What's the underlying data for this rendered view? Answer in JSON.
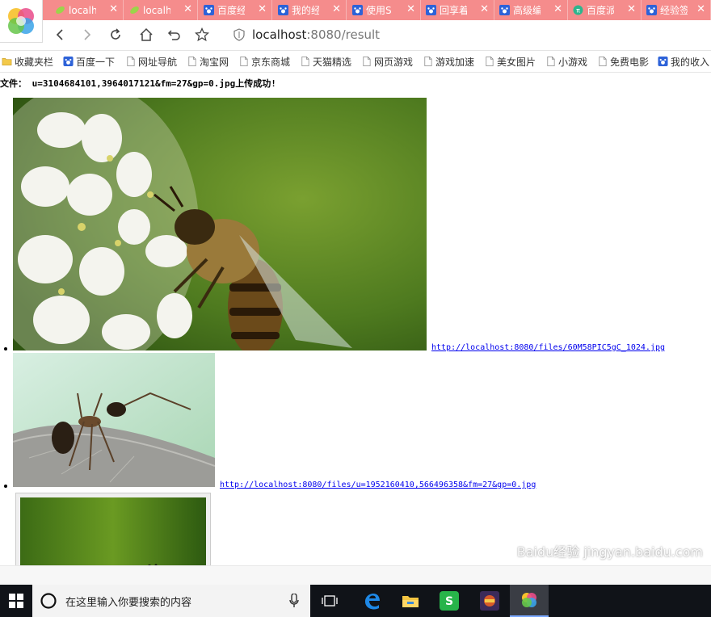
{
  "tabs": [
    {
      "label": "localh",
      "icon": "leaf-icon"
    },
    {
      "label": "localh",
      "icon": "leaf-icon"
    },
    {
      "label": "百度经",
      "icon": "baidu-paw-icon"
    },
    {
      "label": "我的经",
      "icon": "baidu-paw-icon"
    },
    {
      "label": "使用S",
      "icon": "baidu-paw-icon"
    },
    {
      "label": "回享着",
      "icon": "baidu-paw-icon"
    },
    {
      "label": "高级编",
      "icon": "baidu-paw-icon"
    },
    {
      "label": "百度派",
      "icon": "baidu-pai-icon"
    },
    {
      "label": "经验签",
      "icon": "baidu-paw-icon"
    }
  ],
  "address": {
    "host": "localhost",
    "path": ":8080/result"
  },
  "bookmarks": [
    {
      "label": "收藏夹栏",
      "icon": "folder-icon"
    },
    {
      "label": "百度一下",
      "icon": "baidu-paw-icon"
    },
    {
      "label": "网址导航",
      "icon": "page-icon"
    },
    {
      "label": "淘宝网",
      "icon": "page-icon"
    },
    {
      "label": "京东商城",
      "icon": "page-icon"
    },
    {
      "label": "天猫精选",
      "icon": "page-icon"
    },
    {
      "label": "网页游戏",
      "icon": "page-icon"
    },
    {
      "label": "游戏加速",
      "icon": "page-icon"
    },
    {
      "label": "美女图片",
      "icon": "page-icon"
    },
    {
      "label": "小游戏",
      "icon": "page-icon"
    },
    {
      "label": "免费电影",
      "icon": "page-icon"
    },
    {
      "label": "我的收入",
      "icon": "baidu-paw-icon"
    }
  ],
  "page": {
    "message": "文件： u=3104684101,3964017121&fm=27&gp=0.jpg上传成功!",
    "items": [
      {
        "link": "http://localhost:8080/files/60M58PIC5gC_1024.jpg",
        "image": "bee-on-flower"
      },
      {
        "link": "http://localhost:8080/files/u=1952160410,566496358&fm=27&gp=0.jpg",
        "image": "ant-on-leaf"
      },
      {
        "link": "",
        "image": "green-blurred-photo"
      }
    ]
  },
  "taskbar": {
    "search_placeholder": "在这里输入你要搜索的内容",
    "apps": [
      "task-view-icon",
      "edge-icon",
      "file-explorer-icon",
      "green-app-icon",
      "game-app-icon",
      "browser-app-icon"
    ]
  },
  "watermark": "Baidu经验 jingyan.baidu.com"
}
